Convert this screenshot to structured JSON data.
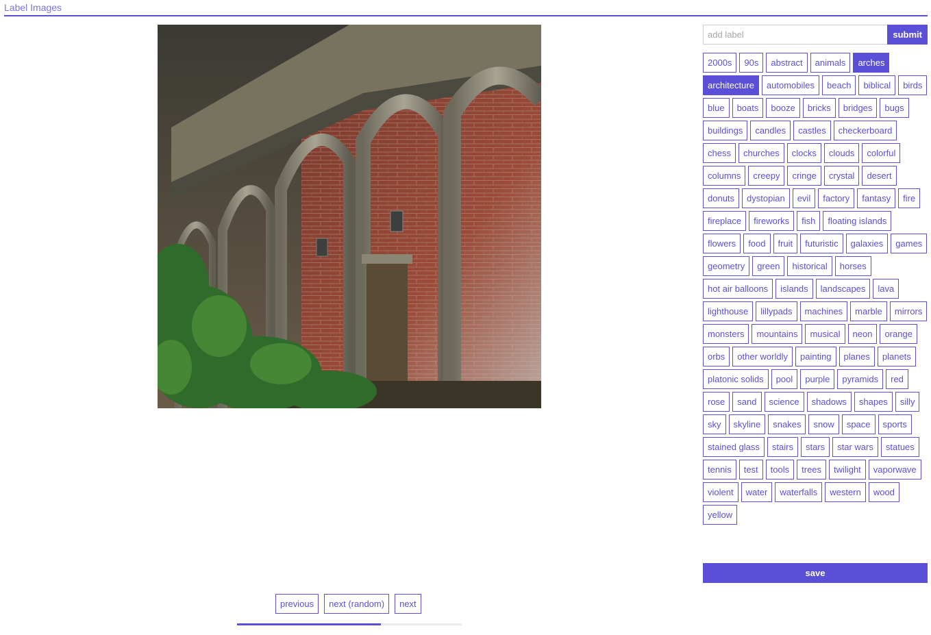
{
  "header": {
    "title": "Label Images"
  },
  "image": {
    "alt": "3D render of a stone arched arcade beside a red brick wall with ivy"
  },
  "nav": {
    "previous": "previous",
    "next_random": "next (random)",
    "next": "next"
  },
  "progress": {
    "fraction": 0.64
  },
  "label_form": {
    "placeholder": "add label",
    "submit_label": "submit"
  },
  "tags": [
    {
      "label": "2000s",
      "selected": false
    },
    {
      "label": "90s",
      "selected": false
    },
    {
      "label": "abstract",
      "selected": false
    },
    {
      "label": "animals",
      "selected": false
    },
    {
      "label": "arches",
      "selected": true
    },
    {
      "label": "architecture",
      "selected": true
    },
    {
      "label": "automobiles",
      "selected": false
    },
    {
      "label": "beach",
      "selected": false
    },
    {
      "label": "biblical",
      "selected": false
    },
    {
      "label": "birds",
      "selected": false
    },
    {
      "label": "blue",
      "selected": false
    },
    {
      "label": "boats",
      "selected": false
    },
    {
      "label": "booze",
      "selected": false
    },
    {
      "label": "bricks",
      "selected": false
    },
    {
      "label": "bridges",
      "selected": false
    },
    {
      "label": "bugs",
      "selected": false
    },
    {
      "label": "buildings",
      "selected": false
    },
    {
      "label": "candles",
      "selected": false
    },
    {
      "label": "castles",
      "selected": false
    },
    {
      "label": "checkerboard",
      "selected": false
    },
    {
      "label": "chess",
      "selected": false
    },
    {
      "label": "churches",
      "selected": false
    },
    {
      "label": "clocks",
      "selected": false
    },
    {
      "label": "clouds",
      "selected": false
    },
    {
      "label": "colorful",
      "selected": false
    },
    {
      "label": "columns",
      "selected": false
    },
    {
      "label": "creepy",
      "selected": false
    },
    {
      "label": "cringe",
      "selected": false
    },
    {
      "label": "crystal",
      "selected": false
    },
    {
      "label": "desert",
      "selected": false
    },
    {
      "label": "donuts",
      "selected": false
    },
    {
      "label": "dystopian",
      "selected": false
    },
    {
      "label": "evil",
      "selected": false
    },
    {
      "label": "factory",
      "selected": false
    },
    {
      "label": "fantasy",
      "selected": false
    },
    {
      "label": "fire",
      "selected": false
    },
    {
      "label": "fireplace",
      "selected": false
    },
    {
      "label": "fireworks",
      "selected": false
    },
    {
      "label": "fish",
      "selected": false
    },
    {
      "label": "floating islands",
      "selected": false
    },
    {
      "label": "flowers",
      "selected": false
    },
    {
      "label": "food",
      "selected": false
    },
    {
      "label": "fruit",
      "selected": false
    },
    {
      "label": "futuristic",
      "selected": false
    },
    {
      "label": "galaxies",
      "selected": false
    },
    {
      "label": "games",
      "selected": false
    },
    {
      "label": "geometry",
      "selected": false
    },
    {
      "label": "green",
      "selected": false
    },
    {
      "label": "historical",
      "selected": false
    },
    {
      "label": "horses",
      "selected": false
    },
    {
      "label": "hot air balloons",
      "selected": false
    },
    {
      "label": "islands",
      "selected": false
    },
    {
      "label": "landscapes",
      "selected": false
    },
    {
      "label": "lava",
      "selected": false
    },
    {
      "label": "lighthouse",
      "selected": false
    },
    {
      "label": "lillypads",
      "selected": false
    },
    {
      "label": "machines",
      "selected": false
    },
    {
      "label": "marble",
      "selected": false
    },
    {
      "label": "mirrors",
      "selected": false
    },
    {
      "label": "monsters",
      "selected": false
    },
    {
      "label": "mountains",
      "selected": false
    },
    {
      "label": "musical",
      "selected": false
    },
    {
      "label": "neon",
      "selected": false
    },
    {
      "label": "orange",
      "selected": false
    },
    {
      "label": "orbs",
      "selected": false
    },
    {
      "label": "other worldly",
      "selected": false
    },
    {
      "label": "painting",
      "selected": false
    },
    {
      "label": "planes",
      "selected": false
    },
    {
      "label": "planets",
      "selected": false
    },
    {
      "label": "platonic solids",
      "selected": false
    },
    {
      "label": "pool",
      "selected": false
    },
    {
      "label": "purple",
      "selected": false
    },
    {
      "label": "pyramids",
      "selected": false
    },
    {
      "label": "red",
      "selected": false
    },
    {
      "label": "rose",
      "selected": false
    },
    {
      "label": "sand",
      "selected": false
    },
    {
      "label": "science",
      "selected": false
    },
    {
      "label": "shadows",
      "selected": false
    },
    {
      "label": "shapes",
      "selected": false
    },
    {
      "label": "silly",
      "selected": false
    },
    {
      "label": "sky",
      "selected": false
    },
    {
      "label": "skyline",
      "selected": false
    },
    {
      "label": "snakes",
      "selected": false
    },
    {
      "label": "snow",
      "selected": false
    },
    {
      "label": "space",
      "selected": false
    },
    {
      "label": "sports",
      "selected": false
    },
    {
      "label": "stained glass",
      "selected": false
    },
    {
      "label": "stairs",
      "selected": false
    },
    {
      "label": "stars",
      "selected": false
    },
    {
      "label": "star wars",
      "selected": false
    },
    {
      "label": "statues",
      "selected": false
    },
    {
      "label": "tennis",
      "selected": false
    },
    {
      "label": "test",
      "selected": false
    },
    {
      "label": "tools",
      "selected": false
    },
    {
      "label": "trees",
      "selected": false
    },
    {
      "label": "twilight",
      "selected": false
    },
    {
      "label": "vaporwave",
      "selected": false
    },
    {
      "label": "violent",
      "selected": false
    },
    {
      "label": "water",
      "selected": false
    },
    {
      "label": "waterfalls",
      "selected": false
    },
    {
      "label": "western",
      "selected": false
    },
    {
      "label": "wood",
      "selected": false
    },
    {
      "label": "yellow",
      "selected": false
    }
  ],
  "save_label": "save",
  "colors": {
    "accent": "#5b4fd8"
  }
}
